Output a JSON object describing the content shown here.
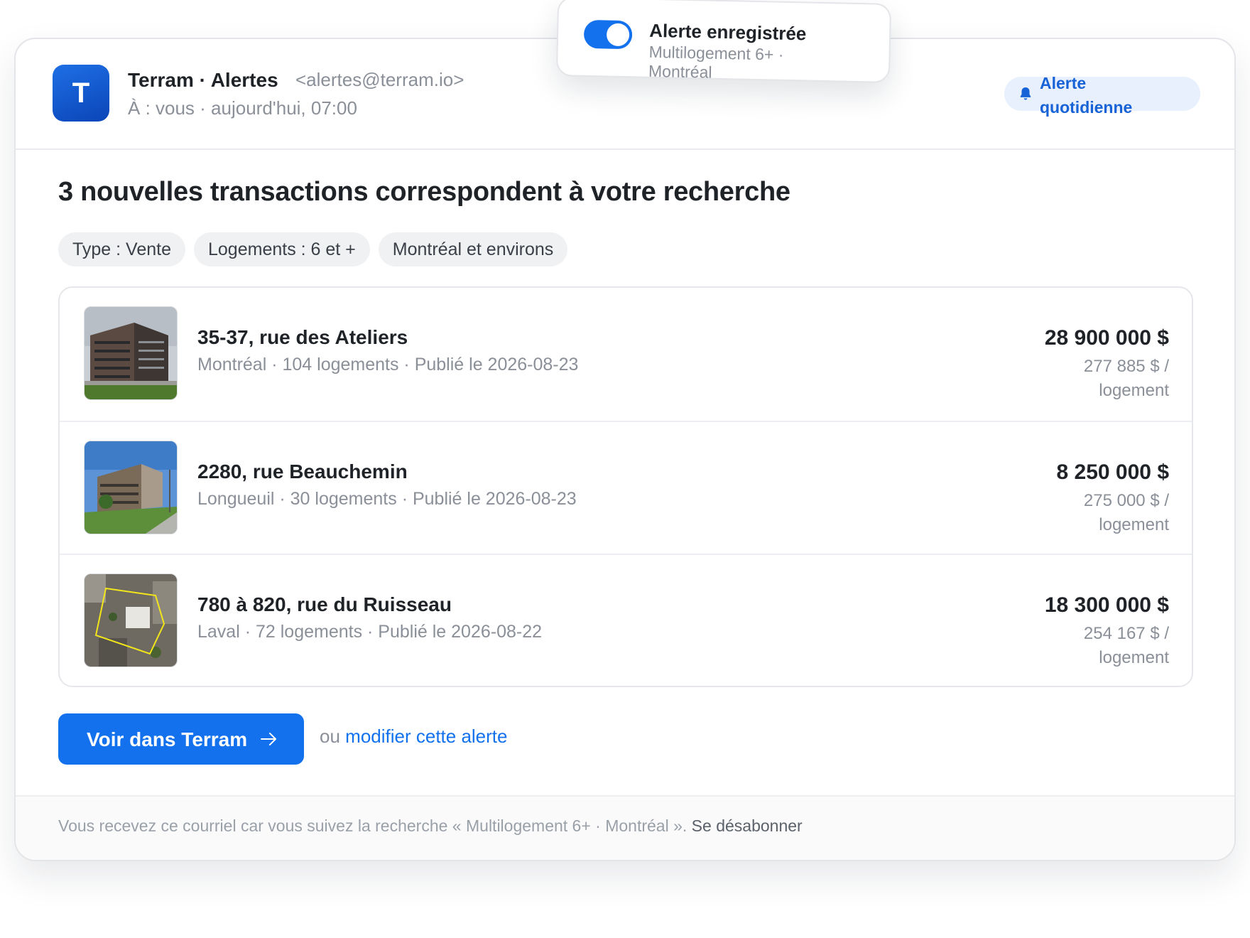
{
  "header": {
    "logo_letter": "T",
    "sender": "Terram · Alertes",
    "sender_email": "<alertes@terram.io>",
    "meta": "À : vous · aujourd'hui, 07:00",
    "badge": "Alerte quotidienne"
  },
  "toast": {
    "title": "Alerte enregistrée",
    "subtitle": "Multilogement 6+ · Montréal",
    "toggle_on": true
  },
  "main": {
    "title": "3 nouvelles transactions correspondent à votre recherche",
    "chips": [
      "Type : Vente",
      "Logements : 6 et +",
      "Montréal et environs"
    ],
    "listings": [
      {
        "address": "35-37, rue des Ateliers",
        "details": "Montréal · 104 logements · Publié le 2026-08-23",
        "price": "28 900 000 $",
        "per_unit": "277 885 $ / logement"
      },
      {
        "address": "2280, rue Beauchemin",
        "details": "Longueuil · 30 logements · Publié le 2026-08-23",
        "price": "8 250 000 $",
        "per_unit": "275 000 $ / logement"
      },
      {
        "address": "780 à 820, rue du Ruisseau",
        "details": "Laval · 72 logements · Publié le 2026-08-22",
        "price": "18 300 000 $",
        "per_unit": "254 167 $ / logement"
      }
    ],
    "cta_label": "Voir dans Terram",
    "or_text": "ou",
    "modify_link": "modifier cette alerte"
  },
  "footer": {
    "text": "Vous recevez ce courriel car vous suivez la recherche « Multilogement 6+ · Montréal ».",
    "unsubscribe": "Se désabonner"
  },
  "colors": {
    "accent": "#1371ee",
    "badge_bg": "#e8f0fd",
    "logo": "#0a45b8"
  },
  "icons": [
    "bell-icon",
    "arrow-right-icon",
    "toggle-switch"
  ]
}
